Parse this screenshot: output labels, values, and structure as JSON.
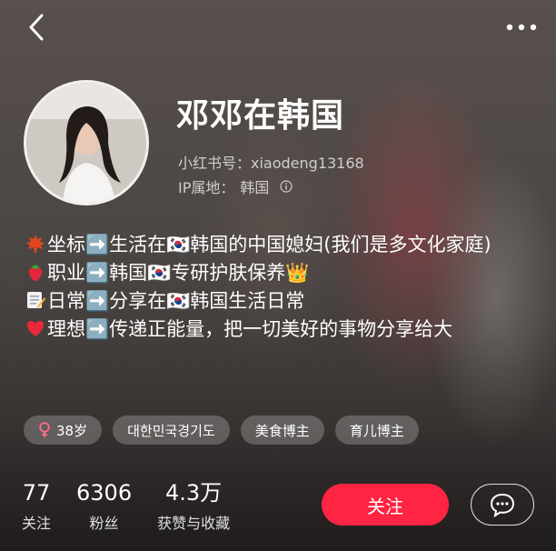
{
  "header": {
    "back_icon": "chevron-left-icon",
    "more_icon": "more-dots-icon"
  },
  "profile": {
    "name": "邓邓在韩国",
    "id_label": "小红书号：",
    "id_value": "xiaodeng13168",
    "ip_label": "IP属地：",
    "ip_value": "韩国"
  },
  "bio": [
    {
      "emoji": "maple-leaf-icon",
      "text": "坐标➡️生活在🇰🇷韩国的中国媳妇(我们是多文化家庭)"
    },
    {
      "emoji": "strawberry-icon",
      "text": "职业➡️韩国🇰🇷专研护肤保养👑"
    },
    {
      "emoji": "memo-icon",
      "text": "日常➡️分享在🇰🇷韩国生活日常"
    },
    {
      "emoji": "heart-icon",
      "text": "理想➡️传递正能量，把一切美好的事物分享给大"
    }
  ],
  "tags": {
    "age": "38岁",
    "location": "대한민국경기도",
    "food": "美食博主",
    "parenting": "育儿博主"
  },
  "stats": {
    "following_count": "77",
    "following_label": "关注",
    "fans_count": "6306",
    "fans_label": "粉丝",
    "likes_count": "4.3万",
    "likes_label": "获赞与收藏"
  },
  "actions": {
    "follow_label": "关注",
    "message_icon": "chat-bubble-icon"
  },
  "colors": {
    "accent": "#ff2442",
    "tag_bg": "rgba(255,255,255,0.22)"
  }
}
